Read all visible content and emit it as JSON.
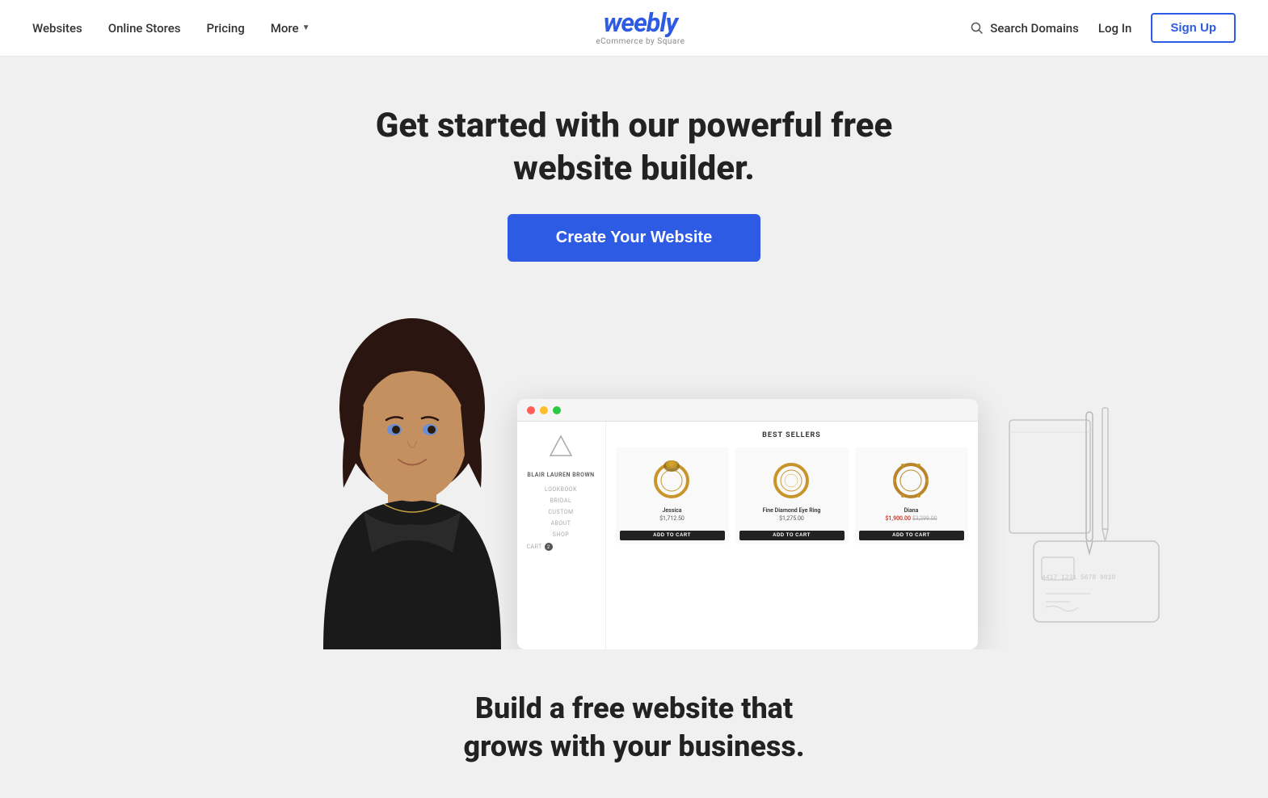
{
  "nav": {
    "links": [
      {
        "id": "websites",
        "label": "Websites"
      },
      {
        "id": "online-stores",
        "label": "Online Stores"
      },
      {
        "id": "pricing",
        "label": "Pricing"
      },
      {
        "id": "more",
        "label": "More"
      }
    ],
    "logo": {
      "text": "weebly",
      "sub": "eCommerce by  Square"
    },
    "search_domains": "Search Domains",
    "login": "Log In",
    "signup": "Sign Up"
  },
  "hero": {
    "title": "Get started with our powerful free website builder.",
    "cta": "Create Your Website"
  },
  "mockup": {
    "titlebar_dots": [
      "red",
      "yellow",
      "green"
    ],
    "sidebar": {
      "brand": "BLAIR LAUREN BROWN",
      "nav_items": [
        "LOOKBOOK",
        "BRIDAL",
        "CUSTOM",
        "ABOUT",
        "SHOP",
        "CART"
      ]
    },
    "main": {
      "section_title": "BEST SELLERS",
      "products": [
        {
          "name": "Jessica",
          "price": "$1,712.50",
          "emoji": "💍",
          "sale": false
        },
        {
          "name": "Fine Diamond Eye Ring",
          "price": "$1,275.00",
          "emoji": "💍",
          "sale": false
        },
        {
          "name": "Diana",
          "price_sale": "$1,900.00",
          "price_orig": "$3,299.00",
          "emoji": "💍",
          "sale": true
        }
      ],
      "add_to_cart": "ADD TO CART"
    }
  },
  "lower": {
    "title": "Build a free website that grows with your business."
  }
}
